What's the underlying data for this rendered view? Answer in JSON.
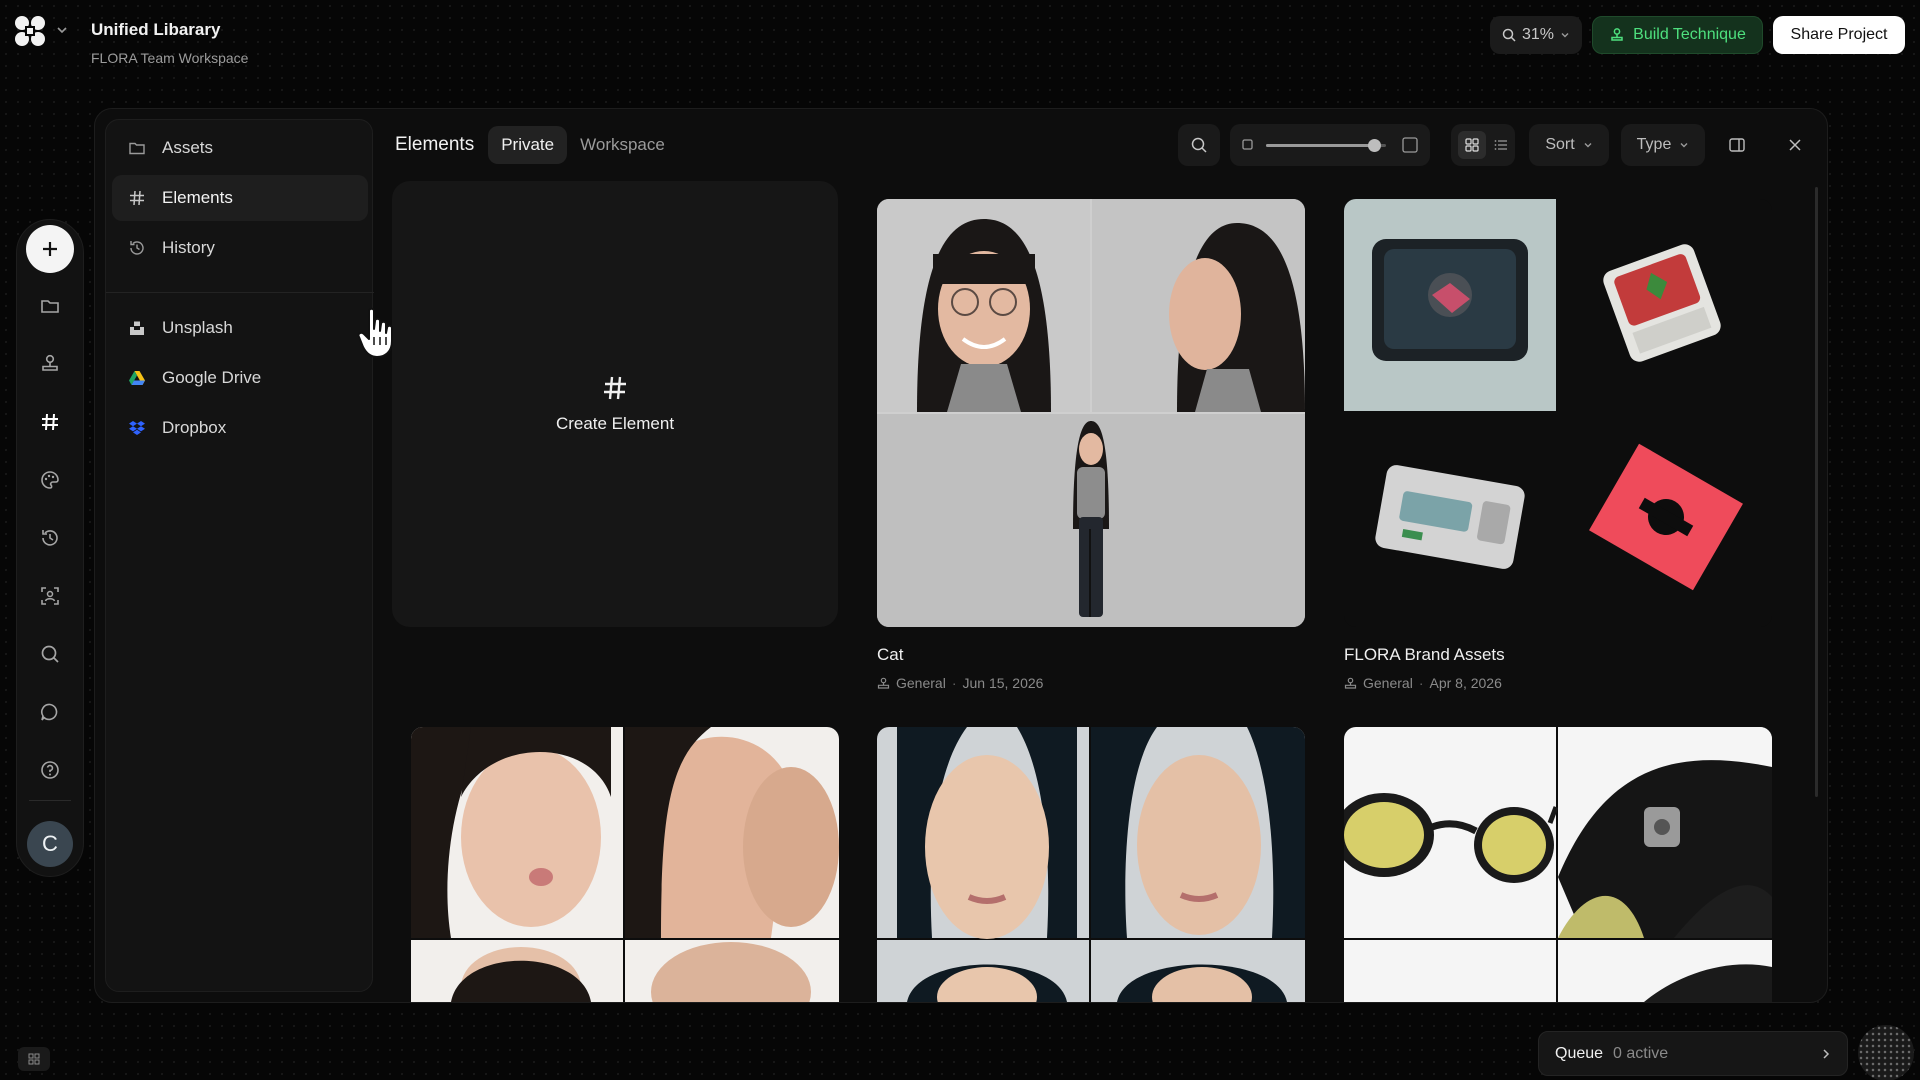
{
  "header": {
    "project_title": "Unified Libarary",
    "workspace_name": "FLORA Team Workspace",
    "zoom_label": "31%",
    "build_label": "Build Technique",
    "share_label": "Share Project"
  },
  "rail": {
    "avatar_initial": "C",
    "icons": [
      "plus-icon",
      "folder-icon",
      "stamp-icon",
      "hash-icon",
      "palette-icon",
      "history-icon",
      "scan-icon",
      "search-icon",
      "chat-icon",
      "help-icon"
    ]
  },
  "sidebar": {
    "items": [
      {
        "label": "Assets",
        "icon": "folder-icon"
      },
      {
        "label": "Elements",
        "icon": "hash-icon",
        "active": true
      },
      {
        "label": "History",
        "icon": "history-icon"
      },
      {
        "label": "Unsplash",
        "icon": "unsplash-icon"
      },
      {
        "label": "Google Drive",
        "icon": "google-drive-icon"
      },
      {
        "label": "Dropbox",
        "icon": "dropbox-icon"
      }
    ]
  },
  "content": {
    "title": "Elements",
    "tabs": [
      {
        "label": "Private",
        "active": true
      },
      {
        "label": "Workspace",
        "active": false
      }
    ],
    "sort_label": "Sort",
    "type_label": "Type",
    "thumb_size_fraction": 0.9,
    "create_label": "Create Element",
    "cards": [
      {
        "title": "Cat",
        "category": "General",
        "date": "Jun 15, 2026"
      },
      {
        "title": "FLORA Brand Assets",
        "category": "General",
        "date": "Apr 8, 2026"
      }
    ]
  },
  "footer": {
    "queue_label": "Queue",
    "queue_status": "0 active"
  },
  "colors": {
    "accent_green": "#4ee07e",
    "build_bg": "#14321d",
    "background": "#060606",
    "panel": "#0d0d0d"
  }
}
